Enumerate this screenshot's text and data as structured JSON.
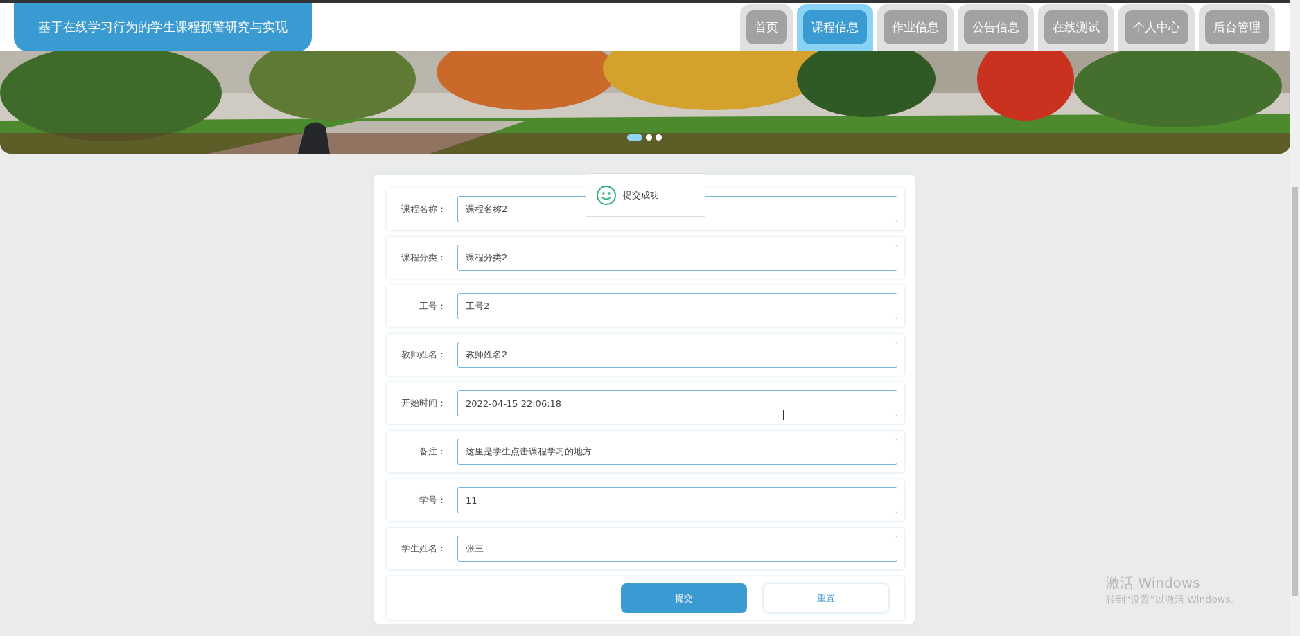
{
  "header": {
    "title": "基于在线学习行为的学生课程预警研究与实现"
  },
  "nav_tabs": [
    {
      "label": "首页",
      "selected": false
    },
    {
      "label": "课程信息",
      "selected": true
    },
    {
      "label": "作业信息",
      "selected": false
    },
    {
      "label": "公告信息",
      "selected": false
    },
    {
      "label": "在线测试",
      "selected": false
    },
    {
      "label": "个人中心",
      "selected": false
    },
    {
      "label": "后台管理",
      "selected": false
    }
  ],
  "banner": {
    "kind": "picture",
    "slides": [
      {
        "selected": true
      },
      {
        "selected": false
      },
      {
        "selected": false
      }
    ]
  },
  "form": {
    "fields": [
      {
        "label": "课程名称：",
        "value": "课程名称2"
      },
      {
        "label": "课程分类：",
        "value": "课程分类2"
      },
      {
        "label": "工号：",
        "value": "工号2"
      },
      {
        "label": "教师姓名：",
        "value": "教师姓名2"
      },
      {
        "label": "开始时间：",
        "value": "2022-04-15 22:06:18"
      },
      {
        "label": "备注：",
        "value": "这里是学生点击课程学习的地方"
      },
      {
        "label": "学号：",
        "value": "11"
      },
      {
        "label": "学生姓名：",
        "value": "张三"
      }
    ],
    "buttons": [
      {
        "kind": "primary",
        "label": "提交"
      },
      {
        "kind": "secondary",
        "label": "重置"
      }
    ]
  },
  "toast": {
    "message": "提交成功"
  },
  "os_notice": {
    "title": "激活 Windows",
    "text": "转到“设置”以激活 Windows。"
  }
}
